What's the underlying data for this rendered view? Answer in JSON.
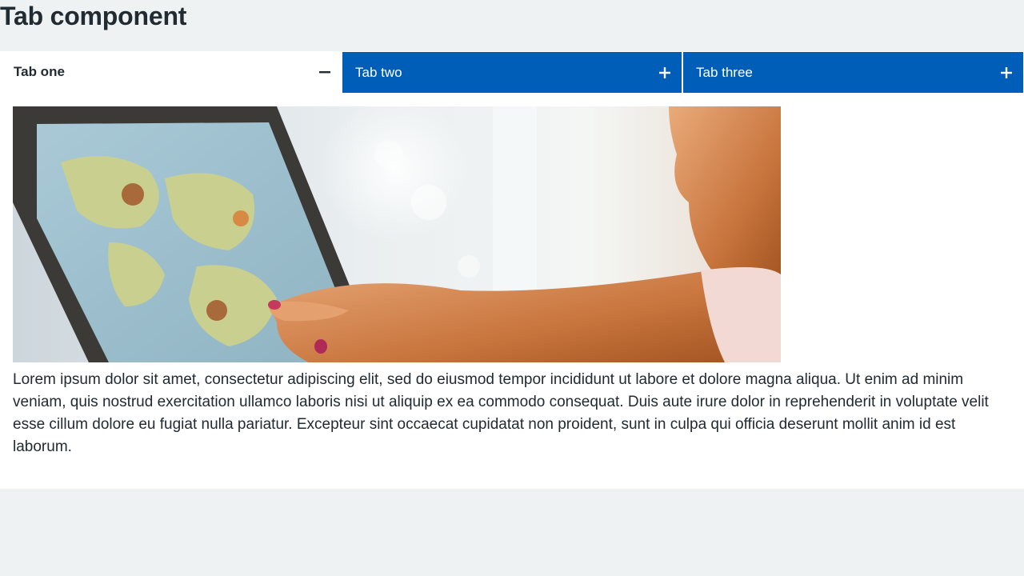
{
  "page": {
    "title": "Tab component"
  },
  "tabs": [
    {
      "label": "Tab one",
      "state": "active",
      "icon": "minus-icon"
    },
    {
      "label": "Tab two",
      "state": "inactive",
      "icon": "plus-icon"
    },
    {
      "label": "Tab three",
      "state": "inactive",
      "icon": "plus-icon"
    }
  ],
  "panel": {
    "image_alt": "Child touching a world map on a tablet",
    "text": "Lorem ipsum dolor sit amet, consectetur adipiscing elit, sed do eiusmod tempor incididunt ut labore et dolore magna aliqua. Ut enim ad minim veniam, quis nostrud exercitation ullamco laboris nisi ut aliquip ex ea commodo consequat. Duis aute irure dolor in reprehenderit in voluptate velit esse cillum dolore eu fugiat nulla pariatur. Excepteur sint occaecat cupidatat non proident, sunt in culpa qui officia deserunt mollit anim id est laborum."
  },
  "colors": {
    "page_background": "#eff2f3",
    "tab_inactive": "#005eb8",
    "text": "#212b32",
    "panel_background": "#ffffff"
  }
}
